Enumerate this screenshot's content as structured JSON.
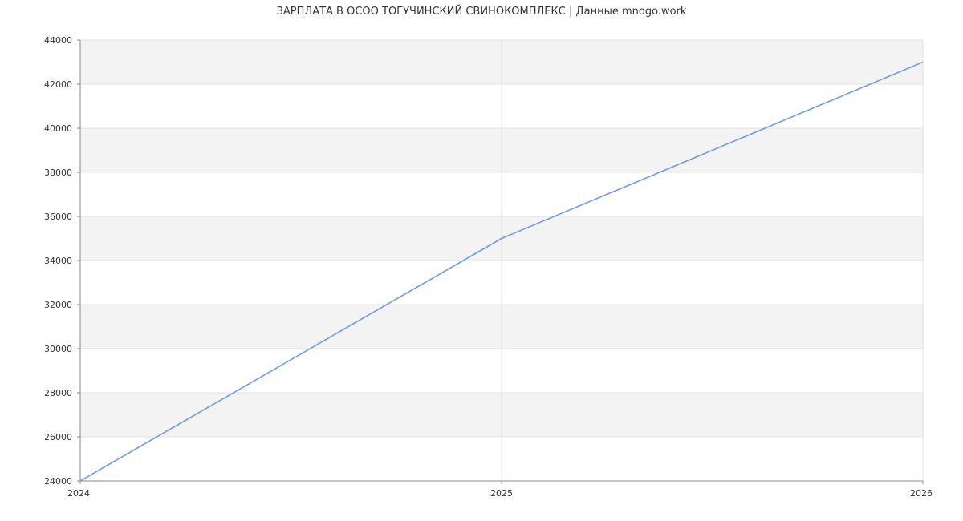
{
  "chart_data": {
    "type": "line",
    "title": "ЗАРПЛАТА В ОСОО ТОГУЧИНСКИЙ СВИНОКОМПЛЕКС | Данные mnogo.work",
    "xlabel": "",
    "ylabel": "",
    "x": [
      "2024",
      "2025",
      "2026"
    ],
    "series": [
      {
        "values": [
          24000,
          35000,
          43000
        ]
      }
    ],
    "xlim": [
      2024,
      2026
    ],
    "ylim": [
      24000,
      44000
    ],
    "yticks": [
      24000,
      26000,
      28000,
      30000,
      32000,
      34000,
      36000,
      38000,
      40000,
      42000,
      44000
    ],
    "xticks": [
      "2024",
      "2025",
      "2026"
    ],
    "grid": true,
    "colors": {
      "line": "#6f9bea",
      "band": "#f3f3f3",
      "grid": "#e2e2e2",
      "axis": "#888888",
      "text": "#333333"
    }
  }
}
